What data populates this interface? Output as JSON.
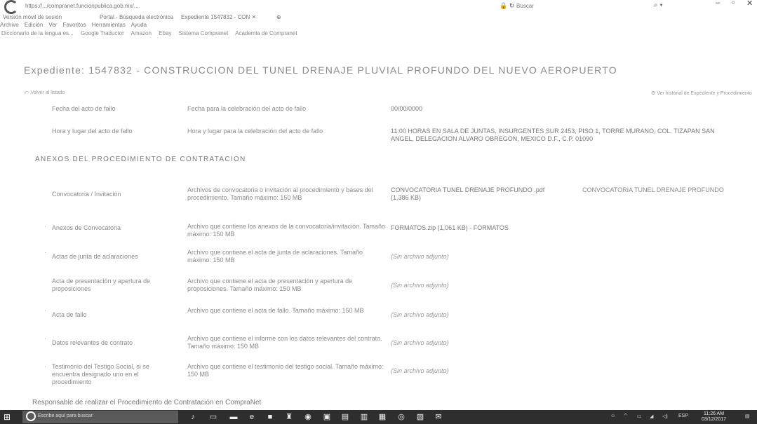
{
  "browser": {
    "url": "https://.../compranet.funcionpublica.gob.mx/...",
    "search_label": "Buscar",
    "tabs": [
      "Versión móvil de sesión",
      "Portal - Búsqueda electrónica",
      "Expediente 1547832 - CON"
    ],
    "menu": [
      "Archivo",
      "Edición",
      "Ver",
      "Favoritos",
      "Herramientas",
      "Ayuda"
    ],
    "favorites": [
      "Diccionario de la lengua es...",
      "Google Traductor",
      "Amazon",
      "Ebay",
      "Sistema Compranet",
      "Academia de Compranet"
    ]
  },
  "page": {
    "title": "Expediente: 1547832 - CONSTRUCCION DEL TUNEL DRENAJE PLUVIAL PROFUNDO DEL NUEVO AEROPUERTO",
    "back_link": "Volver al listado",
    "right_link": "Ver historial de Expediente y Procedimiento",
    "rows_top": [
      {
        "label": "Fecha del acto de fallo",
        "desc": "Fecha para la celebración del acto de fallo",
        "value": "00/00/0000"
      },
      {
        "label": "Hora y lugar del acto de fallo",
        "desc": "Hora y lugar para la celebración del acto de fallo",
        "value": "11:00 HORAS EN SALA DE JUNTAS, INSURGENTES SUR 2453, PISO 1, TORRE MURANO, COL. TIZAPAN SAN ANGEL, DELEGACION ALVARO OBREGON, MEXICO D.F., C.P. 01090"
      }
    ],
    "section_title": "ANEXOS DEL PROCEDIMIENTO DE CONTRATACION",
    "annex_rows": [
      {
        "label": "Convocatoria / Invitación",
        "desc": "Archivos de convocatoria o invitación al procedimiento y bases del procedimiento. Tamaño máximo: 150 MB",
        "value": "CONVOCATORIA TUNEL DRENAJE PROFUNDO .pdf (1,386 KB)",
        "extra": "CONVOCATORIA TUNEL DRENAJE PROFUNDO"
      },
      {
        "label": "Anexos de Convocatoria",
        "desc": "Archivo que contiene los anexos de la convocatoria/invitación. Tamaño máximo: 150 MB",
        "value": "FORMATOS.zip (1,061 KB) - FORMATOS",
        "extra": ""
      },
      {
        "label": "Actas de junta de aclaraciones",
        "desc": "Archivo que contiene el acta de junta de aclaraciones. Tamaño máximo: 150 MB",
        "value": "(Sin archivo adjunto)",
        "extra": ""
      },
      {
        "label": "Acta de presentación y apertura de proposiciones",
        "desc": "Archivo que contiene el acta de presentación y apertura de proposiciones. Tamaño máximo: 150 MB",
        "value": "(Sin archivo adjunto)",
        "extra": ""
      },
      {
        "label": "Acta de fallo",
        "desc": "Archivo que contiene el acta de fallo. Tamaño máximo: 150 MB",
        "value": "(Sin archivo adjunto)",
        "extra": ""
      },
      {
        "label": "Datos relevantes de contrato",
        "desc": "Archivo que contiene el informe con los datos relevantes del contrato. Tamaño máximo: 150 MB",
        "value": "(Sin archivo adjunto)",
        "extra": ""
      },
      {
        "label": "Testimonio del Testigo Social, si se encuentra designado uno en el procedimiento",
        "desc": "Archivo que contiene el testimonio del testigo social. Tamaño máximo: 150 MB",
        "value": "(Sin archivo adjunto)",
        "extra": ""
      }
    ],
    "bottom_text": "Responsable de realizar el Procedimiento de Contratación en CompraNet"
  },
  "taskbar": {
    "search_placeholder": "Escribe aquí para buscar",
    "lang": "ESP",
    "time": "11:26 AM",
    "date": "03/12/2017"
  }
}
